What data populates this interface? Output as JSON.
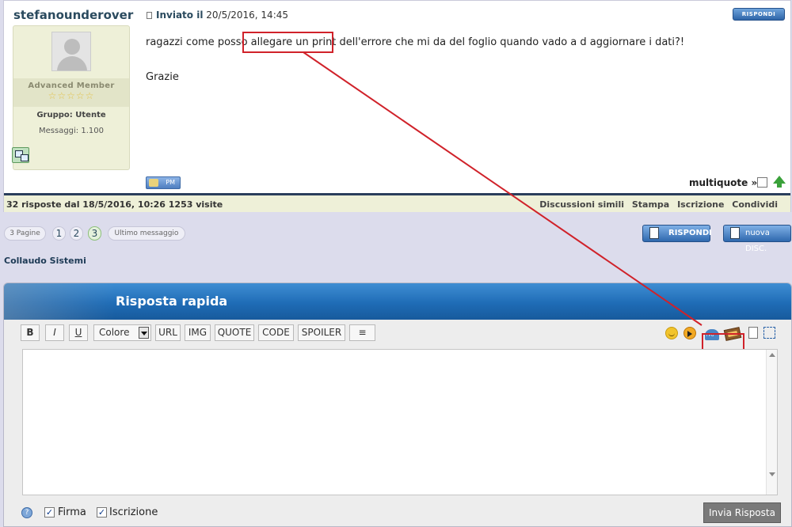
{
  "post": {
    "author": "stefanounderover",
    "meta_label": "Inviato il",
    "meta_date": "20/5/2016, 14:45",
    "reply_small_label": "RISPONDI",
    "rank_title": "Advanced Member",
    "rank_stars": "☆☆☆☆☆",
    "group": "Gruppo: Utente",
    "posts_count": "Messaggi: 1.100",
    "body_part1": "ragazzi come posso ",
    "body_highlight": "allegare un print",
    "body_part2": " dell'errore che mi da del foglio quando vado a d aggiornare i dati?!",
    "body_line2": "Grazie",
    "pm_label": "PM",
    "multiquote_label": "multiquote »"
  },
  "footer": {
    "stats": "32 risposte dal 18/5/2016, 10:26  1253 visite",
    "links": [
      "Discussioni simili",
      "Stampa",
      "Iscrizione",
      "Condividi"
    ]
  },
  "pager": {
    "pages_label": "3 Pagine",
    "pages": [
      "1",
      "2",
      "3"
    ],
    "current": "3",
    "last_label": "Ultimo messaggio"
  },
  "buttons": {
    "respond": "RISPONDI",
    "new_disc": "nuova DISC."
  },
  "forum_name": "Collaudo Sistemi",
  "quick_reply": {
    "title": "Risposta rapida",
    "toolbar": {
      "bold": "B",
      "italic": "I",
      "underline": "U",
      "color": "Colore",
      "url": "URL",
      "img": "IMG",
      "quote": "QUOTE",
      "code": "CODE",
      "spoiler": "SPOILER",
      "center": "≡"
    },
    "help": "?",
    "signature_label": "Firma",
    "subscription_label": "Iscrizione",
    "check_mark": "✓",
    "send_label": "Invia Risposta"
  },
  "colors": {
    "annotation": "#d0222a",
    "header_blue": "#1f6cb6"
  }
}
